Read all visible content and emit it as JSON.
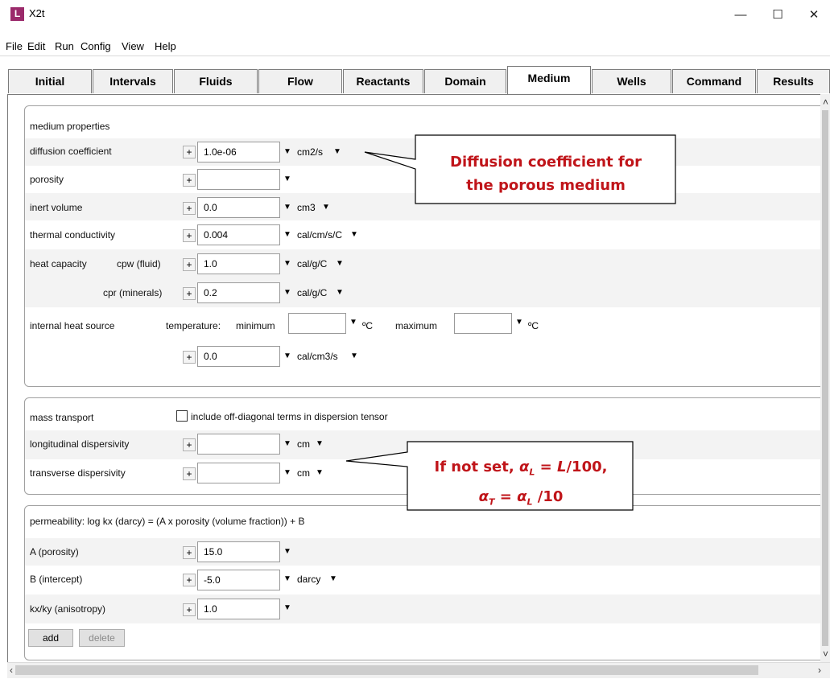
{
  "window": {
    "title": "X2t",
    "app_icon": "L",
    "controls": {
      "minimize": "—",
      "maximize": "☐",
      "close": "✕"
    }
  },
  "menu": [
    "File",
    "Edit",
    "Run",
    "Config",
    "View",
    "Help"
  ],
  "tabs": [
    "Initial",
    "Intervals",
    "Fluids",
    "Flow",
    "Reactants",
    "Domain",
    "Medium",
    "Wells",
    "Command",
    "Results"
  ],
  "active_tab": "Medium",
  "medium_properties": {
    "header": "medium properties",
    "diffusion": {
      "label": "diffusion coefficient",
      "value": "1.0e-06",
      "unit": "cm2/s"
    },
    "porosity": {
      "label": "porosity",
      "value": ""
    },
    "inert_volume": {
      "label": "inert volume",
      "value": "0.0",
      "unit": "cm3"
    },
    "thermal_conductivity": {
      "label": "thermal conductivity",
      "value": "0.004",
      "unit": "cal/cm/s/C"
    },
    "heat_capacity": {
      "label": "heat capacity",
      "cpw_label": "cpw (fluid)",
      "cpw_value": "1.0",
      "cpw_unit": "cal/g/C",
      "cpr_label": "cpr (minerals)",
      "cpr_value": "0.2",
      "cpr_unit": "cal/g/C"
    },
    "internal_heat_source": {
      "label": "internal heat source",
      "temperature_label": "temperature:",
      "minimum_label": "minimum",
      "minimum_value": "",
      "min_unit": "ºC",
      "maximum_label": "maximum",
      "maximum_value": "",
      "max_unit": "ºC",
      "rate_value": "0.0",
      "rate_unit": "cal/cm3/s"
    }
  },
  "mass_transport": {
    "header": "mass transport",
    "offdiag_label": "include off-diagonal terms in dispersion tensor",
    "offdiag_checked": false,
    "longitudinal": {
      "label": "longitudinal dispersivity",
      "value": "",
      "unit": "cm"
    },
    "transverse": {
      "label": "transverse dispersivity",
      "value": "",
      "unit": "cm"
    }
  },
  "permeability": {
    "header": "permeability: log kx (darcy) = (A x porosity (volume fraction)) + B",
    "a": {
      "label": "A (porosity)",
      "value": "15.0"
    },
    "b": {
      "label": "B (intercept)",
      "value": "-5.0",
      "unit": "darcy"
    },
    "anisotropy": {
      "label": "kx/ky (anisotropy)",
      "value": "1.0"
    },
    "add_label": "add",
    "delete_label": "delete"
  },
  "callouts": {
    "diffusion_line1": "Diffusion coefficient for",
    "diffusion_line2": "the porous medium",
    "dispersivity_line1_a": "If not set, ",
    "dispersivity_alpha": "α",
    "dispersivity_sub_l": "L",
    "dispersivity_eq1": " = ",
    "dispersivity_L": "L",
    "dispersivity_div100": "/100,",
    "dispersivity_sub_t": "T",
    "dispersivity_eq2": " = ",
    "dispersivity_div10": " /10"
  },
  "colors": {
    "callout_text": "#c0151a",
    "callout_border": "#000000",
    "app_icon": "#9b2a6b"
  }
}
